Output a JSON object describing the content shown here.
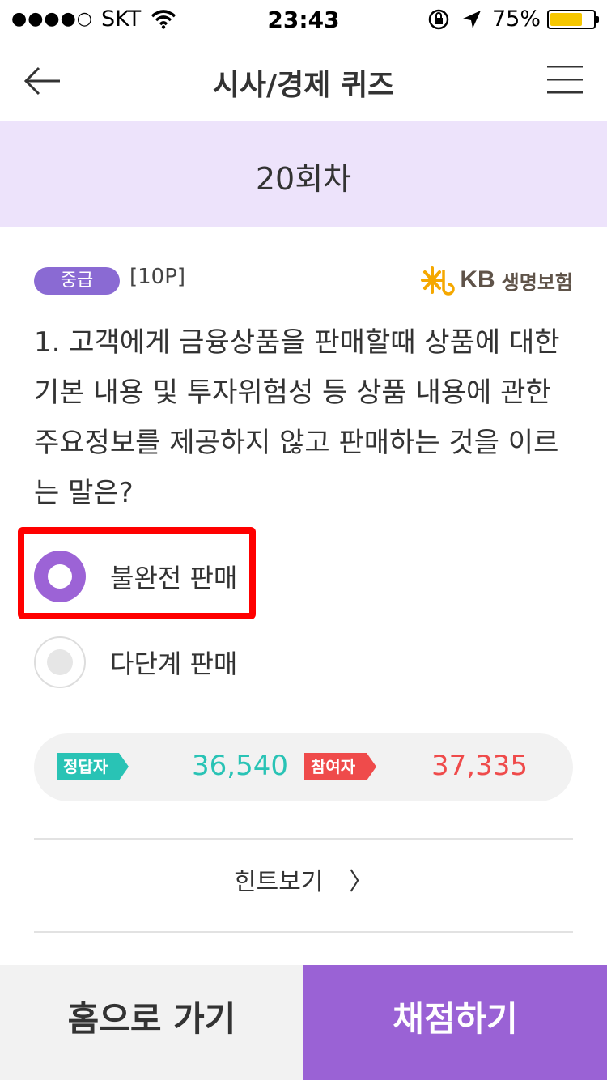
{
  "status_bar": {
    "signal_dots": "●●●●○",
    "carrier": "SKT",
    "time": "23:43",
    "battery_percent": "75%",
    "battery_level": 0.75
  },
  "nav": {
    "title": "시사/경제 퀴즈"
  },
  "banner": {
    "round": "20회차"
  },
  "question": {
    "level": "중급",
    "points": "[10P]",
    "sponsor_brand": "KB",
    "sponsor_name": "생명보험",
    "text": "1. 고객에게 금융상품을 판매할때 상품에 대한 기본 내용 및 투자위험성 등 상품 내용에 관한 주요정보를 제공하지 않고 판매하는 것을 이르는 말은?"
  },
  "options": [
    {
      "label": "불완전 판매",
      "selected": true
    },
    {
      "label": "다단계 판매",
      "selected": false
    }
  ],
  "stats": {
    "correct_label": "정답자",
    "correct_count": "36,540",
    "participants_label": "참여자",
    "participants_count": "37,335"
  },
  "hint": {
    "label": "힌트보기",
    "chevron": "〉"
  },
  "bottom": {
    "home_label": "홈으로 가기",
    "grade_label": "채점하기"
  },
  "colors": {
    "accent": "#9a62d5",
    "banner_bg": "#ede3fb",
    "correct": "#29c3b5",
    "participants": "#ef4b4b",
    "highlight": "#ff0000"
  }
}
